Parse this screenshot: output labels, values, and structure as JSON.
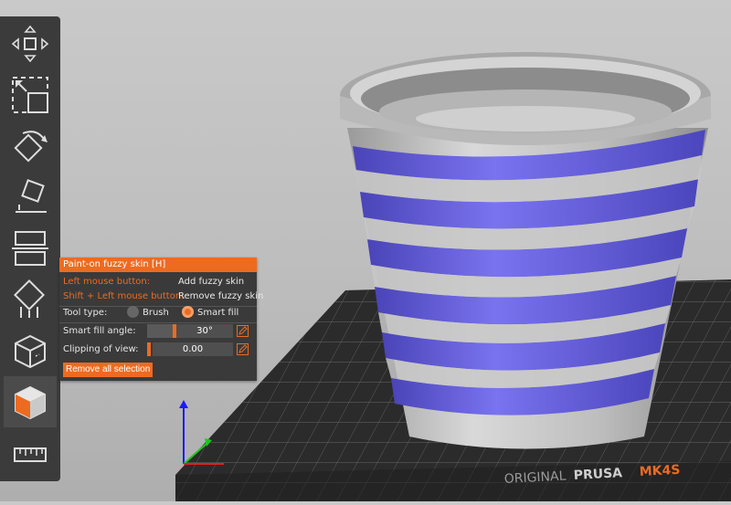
{
  "panel": {
    "title": "Paint-on fuzzy skin [H]",
    "left_mouse_label": "Left mouse button:",
    "left_mouse_action": "Add fuzzy skin",
    "shift_mouse_label": "Shift + Left mouse button:",
    "shift_mouse_action": "Remove fuzzy skin",
    "tool_type_label": "Tool type:",
    "tool_brush": "Brush",
    "tool_smart_fill": "Smart fill",
    "selected_tool": "Smart fill",
    "smart_fill_angle_label": "Smart fill angle:",
    "smart_fill_angle_value": "30°",
    "clipping_label": "Clipping of view:",
    "clipping_value": "0.00",
    "remove_button": "Remove all selection"
  },
  "toolbar": {
    "items": [
      {
        "icon": "move-icon"
      },
      {
        "icon": "scale-icon"
      },
      {
        "icon": "rotate-icon"
      },
      {
        "icon": "place-on-face-icon"
      },
      {
        "icon": "cut-icon"
      },
      {
        "icon": "supports-paint-icon"
      },
      {
        "icon": "seam-paint-icon"
      },
      {
        "icon": "fuzzy-skin-paint-icon",
        "active": true
      },
      {
        "icon": "measure-icon"
      }
    ]
  },
  "bed": {
    "brand_text": "ORIGINAL",
    "brand_name": "PRUSA",
    "model": "MK4S"
  },
  "colors": {
    "accent": "#ed6b21",
    "panel_bg": "#3a3a3a",
    "toolbar_bg": "#3b3b3b",
    "model_gray": "#b8b8b8",
    "fuzzy_paint": "#6a63e0",
    "bed": "#2a2a2a"
  }
}
